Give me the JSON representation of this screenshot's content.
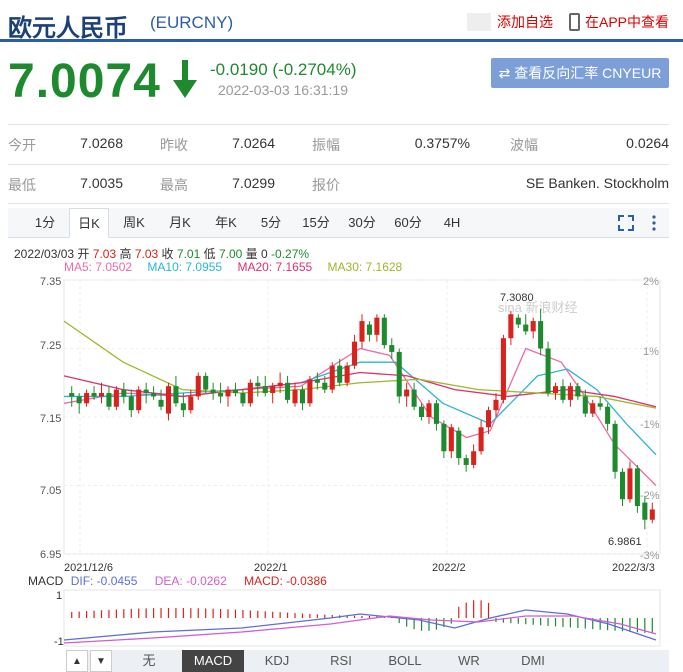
{
  "header": {
    "title": "欧元人民币",
    "code": "(EURCNY)",
    "add_label": "添加自选",
    "app_label": "在APP中查看"
  },
  "quote": {
    "price": "7.0074",
    "change": "-0.0190 (-0.2704%)",
    "timestamp": "2022-03-03 16:31:19",
    "reverse_button": "查看反向汇率 CNYEUR",
    "up_color": "#d9221c",
    "down_color": "#1e8a2e"
  },
  "stats": {
    "row1": [
      {
        "label": "今开",
        "value": "7.0268"
      },
      {
        "label": "昨收",
        "value": "7.0264"
      },
      {
        "label": "振幅",
        "value": "0.3757%"
      },
      {
        "label": "波幅",
        "value": "0.0264"
      }
    ],
    "row2": [
      {
        "label": "最低",
        "value": "7.0035"
      },
      {
        "label": "最高",
        "value": "7.0299"
      },
      {
        "label": "报价",
        "value": ""
      },
      {
        "label": "",
        "value": "SE Banken. Stockholm"
      }
    ]
  },
  "tabs": [
    "1分",
    "日K",
    "周K",
    "月K",
    "年K",
    "5分",
    "15分",
    "30分",
    "60分",
    "4H"
  ],
  "ohlc": {
    "date": "2022/03/03",
    "open_label": "开",
    "open": "7.03",
    "high_label": "高",
    "high": "7.03",
    "close_label": "收",
    "close": "7.01",
    "low_label": "低",
    "low": "7.00",
    "vol_label": "量",
    "vol": "0",
    "pct": "-0.27%"
  },
  "ma": [
    {
      "label": "MA5: 7.0502",
      "color": "#f06aa8"
    },
    {
      "label": "MA10: 7.0955",
      "color": "#2cb5d8"
    },
    {
      "label": "MA20: 7.1655",
      "color": "#e0306c"
    },
    {
      "label": "MA30: 7.1628",
      "color": "#9cb82a"
    }
  ],
  "chart_data": {
    "type": "candlestick",
    "y_ticks": [
      "7.35",
      "7.25",
      "7.15",
      "7.05",
      "6.95"
    ],
    "pct_ticks": [
      "2%",
      "1%",
      "-1%",
      "-2%",
      "-3%"
    ],
    "x_ticks": [
      "2021/12/6",
      "2022/1",
      "2022/2",
      "2022/3/3"
    ],
    "ylim": [
      6.95,
      7.35
    ],
    "high_annotation": "7.3080",
    "low_annotation": "6.9861",
    "watermark": "sina 新浪财经",
    "candles": [
      [
        7.185,
        7.195,
        7.165,
        7.18
      ],
      [
        7.18,
        7.185,
        7.155,
        7.17
      ],
      [
        7.17,
        7.19,
        7.165,
        7.185
      ],
      [
        7.185,
        7.195,
        7.175,
        7.18
      ],
      [
        7.18,
        7.2,
        7.17,
        7.185
      ],
      [
        7.185,
        7.195,
        7.16,
        7.165
      ],
      [
        7.165,
        7.195,
        7.16,
        7.19
      ],
      [
        7.19,
        7.2,
        7.17,
        7.18
      ],
      [
        7.18,
        7.19,
        7.15,
        7.16
      ],
      [
        7.16,
        7.195,
        7.155,
        7.19
      ],
      [
        7.19,
        7.2,
        7.17,
        7.185
      ],
      [
        7.185,
        7.195,
        7.175,
        7.18
      ],
      [
        7.175,
        7.19,
        7.16,
        7.165
      ],
      [
        7.155,
        7.2,
        7.145,
        7.195
      ],
      [
        7.195,
        7.21,
        7.165,
        7.17
      ],
      [
        7.17,
        7.185,
        7.15,
        7.16
      ],
      [
        7.16,
        7.19,
        7.155,
        7.18
      ],
      [
        7.18,
        7.215,
        7.175,
        7.21
      ],
      [
        7.21,
        7.215,
        7.185,
        7.19
      ],
      [
        7.19,
        7.2,
        7.175,
        7.185
      ],
      [
        7.185,
        7.2,
        7.17,
        7.18
      ],
      [
        7.18,
        7.195,
        7.165,
        7.19
      ],
      [
        7.19,
        7.2,
        7.18,
        7.185
      ],
      [
        7.185,
        7.19,
        7.165,
        7.17
      ],
      [
        7.17,
        7.205,
        7.165,
        7.2
      ],
      [
        7.2,
        7.21,
        7.18,
        7.195
      ],
      [
        7.195,
        7.21,
        7.18,
        7.185
      ],
      [
        7.185,
        7.2,
        7.17,
        7.195
      ],
      [
        7.195,
        7.215,
        7.185,
        7.2
      ],
      [
        7.2,
        7.21,
        7.17,
        7.175
      ],
      [
        7.17,
        7.2,
        7.165,
        7.19
      ],
      [
        7.19,
        7.195,
        7.16,
        7.17
      ],
      [
        7.17,
        7.21,
        7.165,
        7.205
      ],
      [
        7.205,
        7.215,
        7.19,
        7.2
      ],
      [
        7.2,
        7.21,
        7.185,
        7.19
      ],
      [
        7.19,
        7.23,
        7.185,
        7.225
      ],
      [
        7.225,
        7.235,
        7.195,
        7.2
      ],
      [
        7.2,
        7.23,
        7.195,
        7.225
      ],
      [
        7.225,
        7.27,
        7.22,
        7.26
      ],
      [
        7.26,
        7.3,
        7.25,
        7.29
      ],
      [
        7.285,
        7.29,
        7.26,
        7.27
      ],
      [
        7.27,
        7.3,
        7.26,
        7.295
      ],
      [
        7.295,
        7.3,
        7.25,
        7.255
      ],
      [
        7.255,
        7.265,
        7.235,
        7.245
      ],
      [
        7.245,
        7.25,
        7.17,
        7.18
      ],
      [
        7.18,
        7.2,
        7.165,
        7.19
      ],
      [
        7.19,
        7.2,
        7.16,
        7.165
      ],
      [
        7.165,
        7.17,
        7.145,
        7.15
      ],
      [
        7.15,
        7.175,
        7.14,
        7.17
      ],
      [
        7.17,
        7.175,
        7.13,
        7.14
      ],
      [
        7.14,
        7.145,
        7.09,
        7.1
      ],
      [
        7.1,
        7.14,
        7.09,
        7.135
      ],
      [
        7.13,
        7.135,
        7.08,
        7.09
      ],
      [
        7.09,
        7.095,
        7.07,
        7.08
      ],
      [
        7.08,
        7.11,
        7.075,
        7.1
      ],
      [
        7.1,
        7.145,
        7.095,
        7.135
      ],
      [
        7.135,
        7.165,
        7.125,
        7.16
      ],
      [
        7.16,
        7.185,
        7.15,
        7.175
      ],
      [
        7.175,
        7.27,
        7.17,
        7.265
      ],
      [
        7.265,
        7.305,
        7.255,
        7.3
      ],
      [
        7.295,
        7.3,
        7.28,
        7.285
      ],
      [
        7.285,
        7.3,
        7.27,
        7.275
      ],
      [
        7.275,
        7.295,
        7.265,
        7.29
      ],
      [
        7.29,
        7.308,
        7.24,
        7.25
      ],
      [
        7.25,
        7.26,
        7.18,
        7.185
      ],
      [
        7.185,
        7.2,
        7.175,
        7.195
      ],
      [
        7.195,
        7.205,
        7.17,
        7.175
      ],
      [
        7.175,
        7.2,
        7.165,
        7.195
      ],
      [
        7.195,
        7.2,
        7.175,
        7.18
      ],
      [
        7.18,
        7.19,
        7.15,
        7.155
      ],
      [
        7.155,
        7.175,
        7.15,
        7.17
      ],
      [
        7.17,
        7.18,
        7.16,
        7.165
      ],
      [
        7.165,
        7.17,
        7.13,
        7.14
      ],
      [
        7.14,
        7.145,
        7.06,
        7.07
      ],
      [
        7.07,
        7.075,
        7.02,
        7.03
      ],
      [
        7.03,
        7.085,
        7.025,
        7.075
      ],
      [
        7.075,
        7.08,
        7.01,
        7.02
      ],
      [
        7.025,
        7.035,
        6.986,
        7.0
      ],
      [
        7.0,
        7.025,
        6.995,
        7.015
      ]
    ],
    "ma_lines": {
      "MA5": [
        [
          0,
          7.17
        ],
        [
          0.1,
          7.185
        ],
        [
          0.2,
          7.18
        ],
        [
          0.3,
          7.19
        ],
        [
          0.4,
          7.195
        ],
        [
          0.5,
          7.25
        ],
        [
          0.55,
          7.24
        ],
        [
          0.62,
          7.15
        ],
        [
          0.68,
          7.12
        ],
        [
          0.72,
          7.13
        ],
        [
          0.78,
          7.25
        ],
        [
          0.84,
          7.23
        ],
        [
          0.88,
          7.18
        ],
        [
          0.93,
          7.11
        ],
        [
          1.0,
          7.05
        ]
      ],
      "MA10": [
        [
          0,
          7.18
        ],
        [
          0.1,
          7.18
        ],
        [
          0.2,
          7.185
        ],
        [
          0.3,
          7.19
        ],
        [
          0.4,
          7.2
        ],
        [
          0.5,
          7.23
        ],
        [
          0.56,
          7.23
        ],
        [
          0.64,
          7.17
        ],
        [
          0.72,
          7.14
        ],
        [
          0.8,
          7.21
        ],
        [
          0.85,
          7.22
        ],
        [
          0.9,
          7.19
        ],
        [
          0.95,
          7.14
        ],
        [
          1.0,
          7.095
        ]
      ],
      "MA20": [
        [
          0,
          7.21
        ],
        [
          0.1,
          7.19
        ],
        [
          0.2,
          7.18
        ],
        [
          0.3,
          7.19
        ],
        [
          0.4,
          7.2
        ],
        [
          0.5,
          7.215
        ],
        [
          0.58,
          7.21
        ],
        [
          0.66,
          7.19
        ],
        [
          0.75,
          7.18
        ],
        [
          0.85,
          7.19
        ],
        [
          0.93,
          7.18
        ],
        [
          1.0,
          7.165
        ]
      ],
      "MA30": [
        [
          0,
          7.29
        ],
        [
          0.1,
          7.23
        ],
        [
          0.2,
          7.19
        ],
        [
          0.3,
          7.185
        ],
        [
          0.4,
          7.19
        ],
        [
          0.5,
          7.2
        ],
        [
          0.6,
          7.205
        ],
        [
          0.7,
          7.19
        ],
        [
          0.8,
          7.185
        ],
        [
          0.9,
          7.18
        ],
        [
          1.0,
          7.163
        ]
      ]
    },
    "macd": {
      "label": "MACD",
      "dif": "DIF: -0.0455",
      "dea": "DEA: -0.0262",
      "macd": "MACD: -0.0386",
      "y_ticks": [
        "1",
        "-1"
      ]
    }
  },
  "bottom_tabs": [
    "无",
    "MACD",
    "KDJ",
    "RSI",
    "BOLL",
    "WR",
    "DMI"
  ],
  "bottom_nav": [
    "▲",
    "▼"
  ]
}
